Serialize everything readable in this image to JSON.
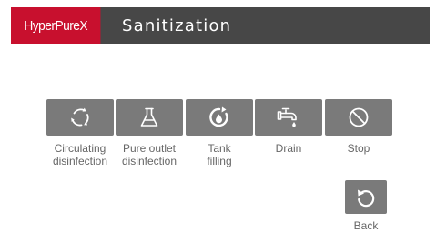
{
  "header": {
    "brand": "HyperPureX",
    "title": "Sanitization"
  },
  "actions": [
    {
      "icon": "circular-arrows-icon",
      "label_line1": "Circulating",
      "label_line2": "disinfection"
    },
    {
      "icon": "flask-icon",
      "label_line1": "Pure outlet",
      "label_line2": "disinfection"
    },
    {
      "icon": "droplet-refill-icon",
      "label_line1": "Tank",
      "label_line2": "filling"
    },
    {
      "icon": "faucet-icon",
      "label_line1": "Drain",
      "label_line2": ""
    },
    {
      "icon": "stop-icon",
      "label_line1": "Stop",
      "label_line2": ""
    }
  ],
  "back": {
    "icon": "back-arrow-icon",
    "label": "Back"
  },
  "colors": {
    "header_bg": "#474747",
    "brand_bg": "#c8102e",
    "button_bg": "#7a7a7a",
    "label_text": "#666666"
  }
}
